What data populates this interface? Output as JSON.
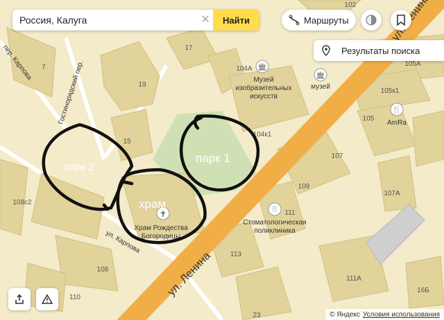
{
  "search": {
    "value": "Россия, Калуга",
    "find_label": "Найти"
  },
  "routes": {
    "label": "Маршруты"
  },
  "results": {
    "label": "Результаты поиска"
  },
  "streets": {
    "lenina": "ул. Ленина",
    "karpova_top": "пер. Карпова",
    "gostinoryadsky": "Гостинорядский пер.",
    "karpova": "ул. Карпова"
  },
  "buildings": {
    "b102": "102",
    "b17": "17",
    "b7": "7",
    "b19": "19",
    "b104a": "104А",
    "b105a": "105А",
    "b105k1": "105к1",
    "b105": "105",
    "b104k1": "104к1",
    "b15": "15",
    "b107": "107",
    "b109": "109",
    "b107a": "107А",
    "b108c2": "108с2",
    "b111": "111",
    "b113": "113",
    "b108": "108",
    "b110": "110",
    "b111a": "111А",
    "b16b": "16Б",
    "b23": "23"
  },
  "pois": {
    "museum_main": "Музей изобразительных искусств",
    "museum": "музей",
    "amra": "AmRa",
    "clinic": "Стоматологическая поликлиника",
    "church": "Храм Рождества Богородицы"
  },
  "annotations": {
    "park1": "парк 1",
    "park2": "парк 2",
    "hram": "храм"
  },
  "footer": {
    "copyright": "© Яндекс",
    "terms": "Условия использования"
  },
  "colors": {
    "background": "#f3ebc9",
    "building": "#e2d39b",
    "road": "#f4b24a",
    "park": "#cfe1b4",
    "accent": "#ffdb4d"
  }
}
